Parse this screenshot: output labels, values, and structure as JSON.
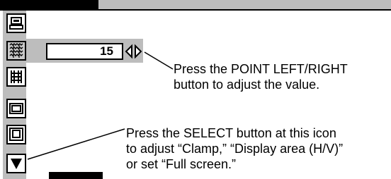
{
  "menu": {
    "value": "15",
    "icons": [
      "screen-icon",
      "pitch-icon",
      "phase-icon",
      "horizontal-position-icon",
      "vertical-position-icon",
      "scroll-down-icon"
    ]
  },
  "callouts": {
    "point": "Press the POINT LEFT/RIGHT\nbutton to adjust the value.",
    "select": "Press the SELECT button at this icon\nto adjust “Clamp,” “Display area (H/V)”\nor set “Full screen.”"
  }
}
